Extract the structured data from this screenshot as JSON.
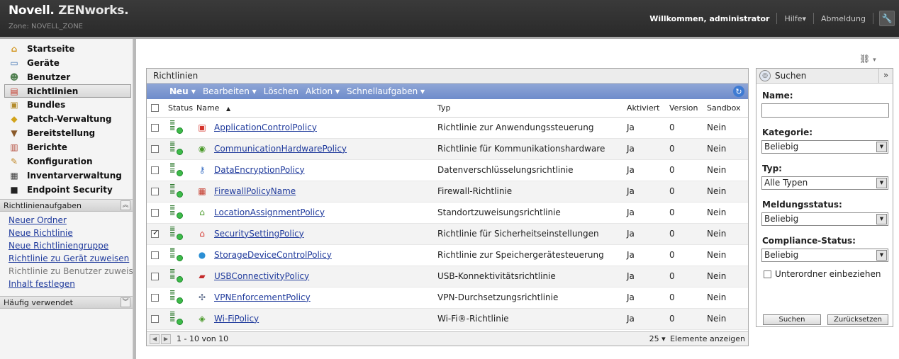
{
  "header": {
    "brand_novell": "Novell.",
    "brand_product": "ZENworks.",
    "zone": "Zone: NOVELL_ZONE",
    "welcome": "Willkommen, administrator",
    "help": "Hilfe▾",
    "logout": "Abmeldung",
    "tool_icon": "wrench-icon"
  },
  "sidebar": {
    "items": [
      {
        "label": "Startseite",
        "icon": "home-icon"
      },
      {
        "label": "Geräte",
        "icon": "monitor-icon"
      },
      {
        "label": "Benutzer",
        "icon": "users-icon"
      },
      {
        "label": "Richtlinien",
        "icon": "policy-icon"
      },
      {
        "label": "Bundles",
        "icon": "bundle-icon"
      },
      {
        "label": "Patch-Verwaltung",
        "icon": "shield-icon"
      },
      {
        "label": "Bereitstellung",
        "icon": "deploy-icon"
      },
      {
        "label": "Berichte",
        "icon": "report-icon"
      },
      {
        "label": "Konfiguration",
        "icon": "wrench-icon"
      },
      {
        "label": "Inventarverwaltung",
        "icon": "inventory-icon"
      },
      {
        "label": "Endpoint Security",
        "icon": "security-icon"
      }
    ],
    "tasks_title": "Richtlinienaufgaben",
    "tasks": [
      {
        "label": "Neuer Ordner"
      },
      {
        "label": "Neue Richtlinie"
      },
      {
        "label": "Neue Richtliniengruppe"
      },
      {
        "label": "Richtlinie zu Gerät zuweisen"
      },
      {
        "label": "Richtlinie zu Benutzer zuweisen"
      },
      {
        "label": "Inhalt festlegen"
      }
    ],
    "frequent_title": "Häufig verwendet"
  },
  "main": {
    "panel_title": "Richtlinien",
    "toolbar": {
      "new": "Neu ▾",
      "edit": "Bearbeiten ▾",
      "delete": "Löschen",
      "action": "Aktion ▾",
      "quick_tasks": "Schnellaufgaben ▾"
    },
    "columns": {
      "status": "Status",
      "name": "Name",
      "name_sort": "▲",
      "type": "Typ",
      "enabled": "Aktiviert",
      "version": "Version",
      "sandbox": "Sandbox"
    },
    "rows": [
      {
        "name": "ApplicationControlPolicy",
        "type": "Richtlinie zur Anwendungssteuerung",
        "enabled": "Ja",
        "version": "0",
        "sandbox": "Nein",
        "checked": false,
        "icon": "app-control-icon",
        "color": "#d4332b",
        "glyph": "▣"
      },
      {
        "name": "CommunicationHardwarePolicy",
        "type": "Richtlinie für Kommunikationshardware",
        "enabled": "Ja",
        "version": "0",
        "sandbox": "Nein",
        "checked": false,
        "icon": "communication-icon",
        "color": "#4a9a2a",
        "glyph": "◉"
      },
      {
        "name": "DataEncryptionPolicy",
        "type": "Datenverschlüsselungsrichtlinie",
        "enabled": "Ja",
        "version": "0",
        "sandbox": "Nein",
        "checked": false,
        "icon": "encryption-icon",
        "color": "#3a6fc4",
        "glyph": "⚷"
      },
      {
        "name": "FirewallPolicyName",
        "type": "Firewall-Richtlinie",
        "enabled": "Ja",
        "version": "0",
        "sandbox": "Nein",
        "checked": false,
        "icon": "firewall-icon",
        "color": "#c43a2b",
        "glyph": "▦"
      },
      {
        "name": "LocationAssignmentPolicy",
        "type": "Standortzuweisungsrichtlinie",
        "enabled": "Ja",
        "version": "0",
        "sandbox": "Nein",
        "checked": false,
        "icon": "location-icon",
        "color": "#4a9a2a",
        "glyph": "⌂"
      },
      {
        "name": "SecuritySettingPolicy",
        "type": "Richtlinie für Sicherheitseinstellungen",
        "enabled": "Ja",
        "version": "0",
        "sandbox": "Nein",
        "checked": true,
        "icon": "security-setting-icon",
        "color": "#d4332b",
        "glyph": "⌂"
      },
      {
        "name": "StorageDeviceControlPolicy",
        "type": "Richtlinie zur Speichergerätesteuerung",
        "enabled": "Ja",
        "version": "0",
        "sandbox": "Nein",
        "checked": false,
        "icon": "storage-icon",
        "color": "#2b8fd4",
        "glyph": "●"
      },
      {
        "name": "USBConnectivityPolicy",
        "type": "USB-Konnektivitätsrichtlinie",
        "enabled": "Ja",
        "version": "0",
        "sandbox": "Nein",
        "checked": false,
        "icon": "usb-icon",
        "color": "#c42b2b",
        "glyph": "▰"
      },
      {
        "name": "VPNEnforcementPolicy",
        "type": "VPN-Durchsetzungsrichtlinie",
        "enabled": "Ja",
        "version": "0",
        "sandbox": "Nein",
        "checked": false,
        "icon": "vpn-icon",
        "color": "#5a6a8a",
        "glyph": "✣"
      },
      {
        "name": "Wi-FiPolicy",
        "type": "Wi-Fi®-Richtlinie",
        "enabled": "Ja",
        "version": "0",
        "sandbox": "Nein",
        "checked": false,
        "icon": "wifi-icon",
        "color": "#4a9a2a",
        "glyph": "◈"
      }
    ],
    "pager": {
      "info": "1 - 10 von 10",
      "page_size": "25 ▾",
      "show_label": "Elemente anzeigen"
    }
  },
  "search": {
    "title": "Suchen",
    "name_label": "Name:",
    "name_value": "",
    "category_label": "Kategorie:",
    "category_value": "Beliebig",
    "type_label": "Typ:",
    "type_value": "Alle Typen",
    "message_label": "Meldungsstatus:",
    "message_value": "Beliebig",
    "compliance_label": "Compliance-Status:",
    "compliance_value": "Beliebig",
    "subfolders_label": "Unterordner einbeziehen",
    "search_button": "Suchen",
    "reset_button": "Zurücksetzen"
  }
}
